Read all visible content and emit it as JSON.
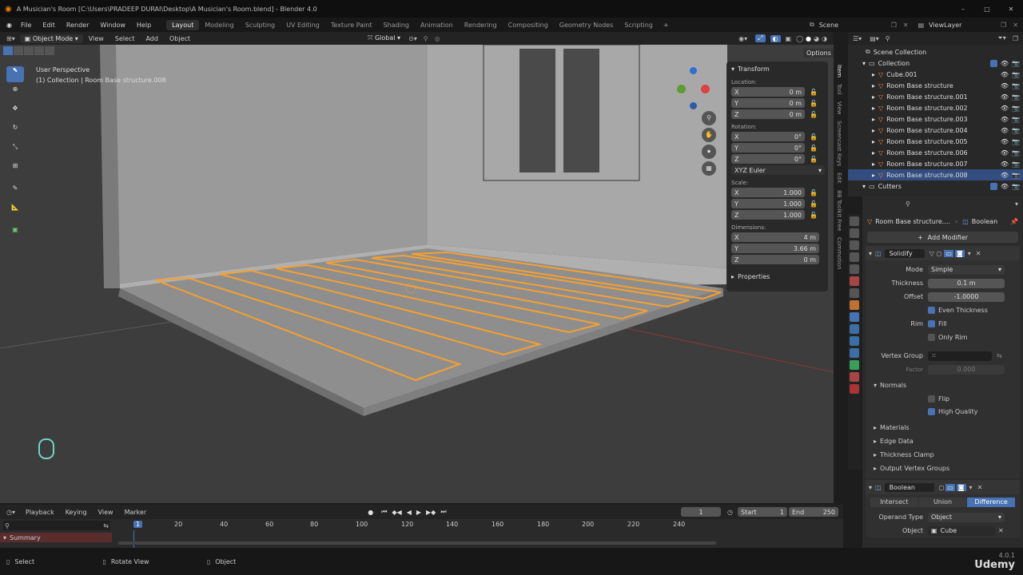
{
  "app": {
    "window_title": "A Musician's Room [C:\\Users\\PRADEEP DURAI\\Desktop\\A Musician's Room.blend] - Blender 4.0",
    "version": "4.0.1",
    "watermark": "Udemy"
  },
  "menubar": {
    "items": [
      "File",
      "Edit",
      "Render",
      "Window",
      "Help"
    ],
    "workspaces": [
      "Layout",
      "Modeling",
      "Sculpting",
      "UV Editing",
      "Texture Paint",
      "Shading",
      "Animation",
      "Rendering",
      "Compositing",
      "Geometry Nodes",
      "Scripting"
    ],
    "active_workspace": "Layout",
    "scene": "Scene",
    "view_layer": "ViewLayer"
  },
  "viewport_header": {
    "mode": "Object Mode",
    "menus": [
      "View",
      "Select",
      "Add",
      "Object"
    ],
    "orientation": "Global",
    "options": "Options"
  },
  "viewport": {
    "perspective": "User Perspective",
    "context": "(1) Collection | Room Base structure.008"
  },
  "npanel": {
    "transform_title": "Transform",
    "location_label": "Location:",
    "location": [
      {
        "axis": "X",
        "value": "0 m"
      },
      {
        "axis": "Y",
        "value": "0 m"
      },
      {
        "axis": "Z",
        "value": "0 m"
      }
    ],
    "rotation_label": "Rotation:",
    "rotation": [
      {
        "axis": "X",
        "value": "0°"
      },
      {
        "axis": "Y",
        "value": "0°"
      },
      {
        "axis": "Z",
        "value": "0°"
      }
    ],
    "rotation_mode": "XYZ Euler",
    "scale_label": "Scale:",
    "scale": [
      {
        "axis": "X",
        "value": "1.000"
      },
      {
        "axis": "Y",
        "value": "1.000"
      },
      {
        "axis": "Z",
        "value": "1.000"
      }
    ],
    "dimensions_label": "Dimensions:",
    "dimensions": [
      {
        "axis": "X",
        "value": "4 m"
      },
      {
        "axis": "Y",
        "value": "3.66 m"
      },
      {
        "axis": "Z",
        "value": "0 m"
      }
    ],
    "properties_title": "Properties"
  },
  "side_tabs": [
    "Item",
    "Tool",
    "View",
    "Screencast Keys",
    "Edit",
    "BB Toolkit Free",
    "Commotion"
  ],
  "outliner": {
    "scene_collection": "Scene Collection",
    "collection": "Collection",
    "items": [
      "Cube.001",
      "Room Base structure",
      "Room Base structure.001",
      "Room Base structure.002",
      "Room Base structure.003",
      "Room Base structure.004",
      "Room Base structure.005",
      "Room Base structure.006",
      "Room Base structure.007",
      "Room Base structure.008"
    ],
    "selected_item": "Room Base structure.008",
    "cutters": "Cutters"
  },
  "properties": {
    "breadcrumb_object": "Room Base structure....",
    "breadcrumb_modifier": "Boolean",
    "add_modifier": "Add Modifier",
    "solidify": {
      "name": "Solidify",
      "mode_label": "Mode",
      "mode": "Simple",
      "thickness_label": "Thickness",
      "thickness": "0.1 m",
      "offset_label": "Offset",
      "offset": "-1.0000",
      "even_thickness": "Even Thickness",
      "rim_label": "Rim",
      "fill": "Fill",
      "only_rim": "Only Rim",
      "vertex_group_label": "Vertex Group",
      "factor_label": "Factor",
      "factor": "0.000",
      "normals": "Normals",
      "flip": "Flip",
      "high_quality": "High Quality",
      "sections": [
        "Materials",
        "Edge Data",
        "Thickness Clamp",
        "Output Vertex Groups"
      ]
    },
    "boolean": {
      "name": "Boolean",
      "ops": [
        "Intersect",
        "Union",
        "Difference"
      ],
      "active_op": "Difference",
      "operand_type_label": "Operand Type",
      "operand_type": "Object",
      "object_label": "Object",
      "object": "Cube"
    }
  },
  "timeline": {
    "menus": [
      "Playback",
      "Keying",
      "View",
      "Marker"
    ],
    "current_frame": "1",
    "start_label": "Start",
    "start": "1",
    "end_label": "End",
    "end": "250",
    "ticks": [
      "1",
      "20",
      "40",
      "60",
      "80",
      "100",
      "120",
      "140",
      "160",
      "180",
      "200",
      "220",
      "240"
    ],
    "summary": "Summary"
  },
  "statusbar": {
    "select": "Select",
    "rotate_view": "Rotate View",
    "object": "Object"
  },
  "colors": {
    "selection": "#f5a031",
    "active_blue": "#4772b3",
    "highlight_row": "#334d80"
  }
}
